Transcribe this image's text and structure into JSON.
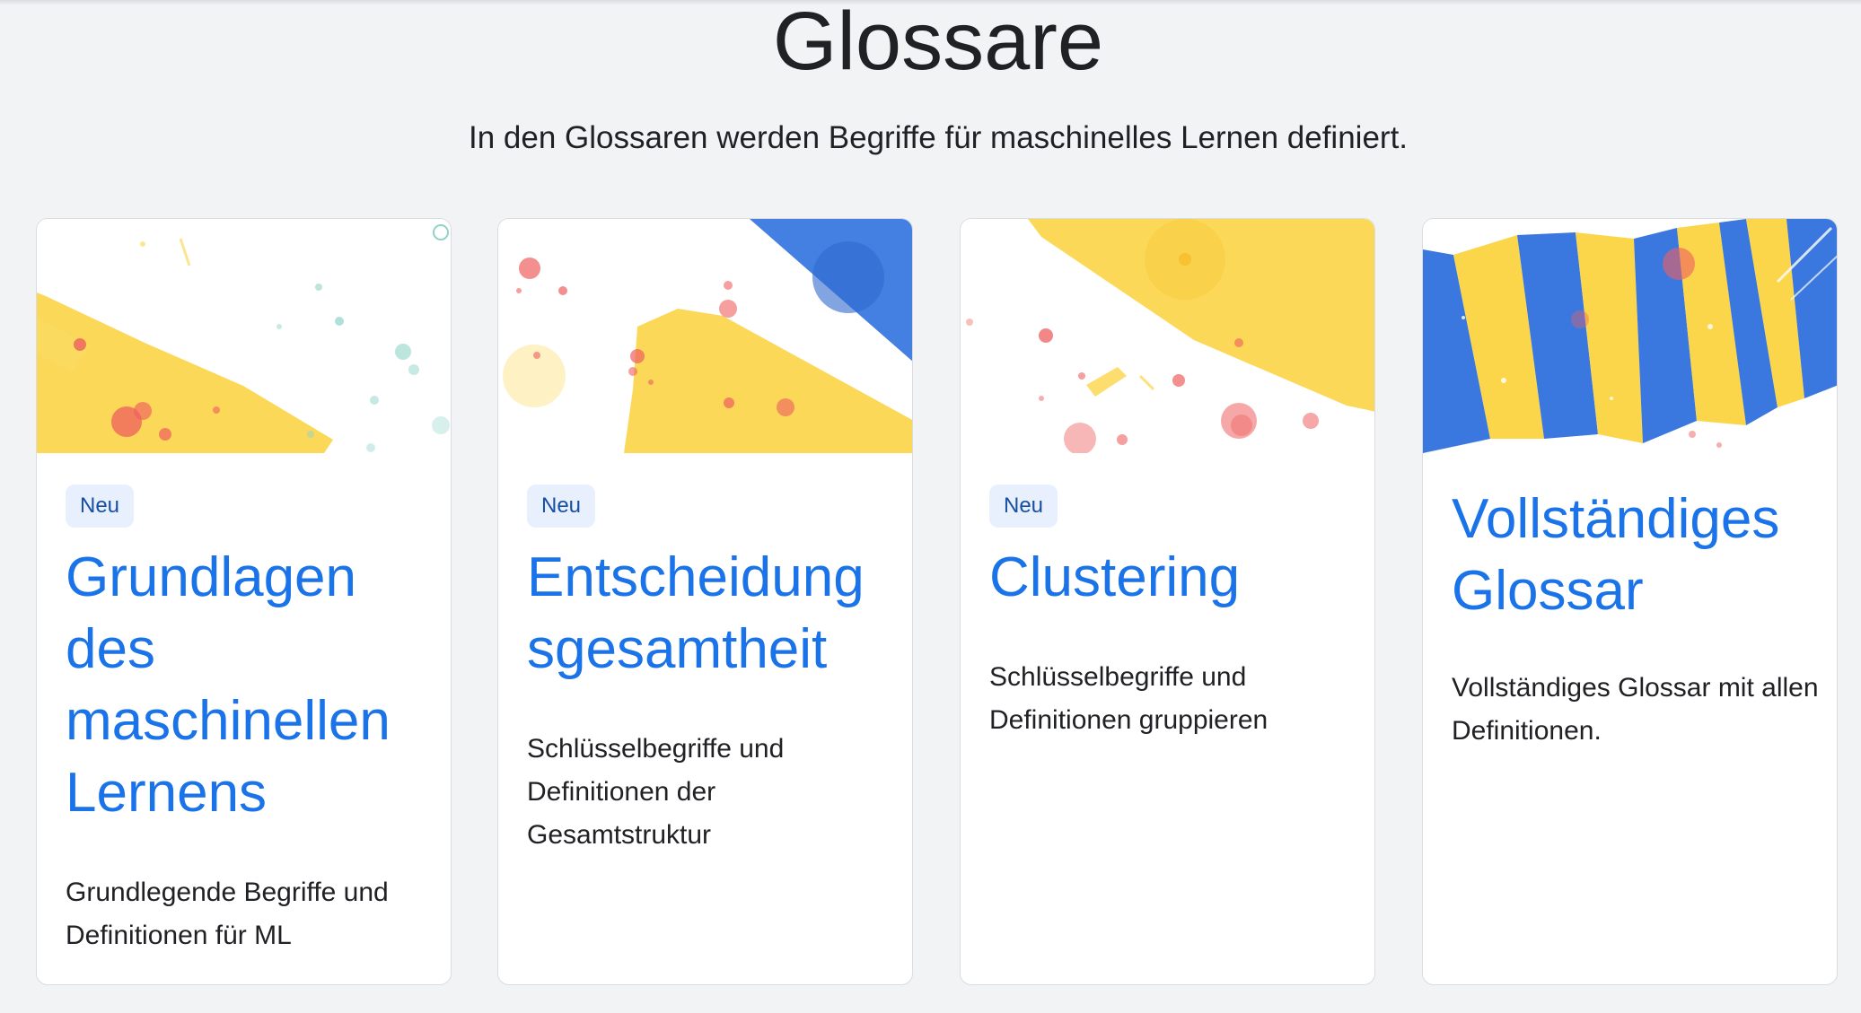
{
  "header": {
    "title": "Glossare",
    "subtitle": "In den Glossaren werden Begriffe für maschinelles Lernen definiert."
  },
  "cards": [
    {
      "badge": "Neu",
      "title": "Grundlagen des maschinellen Lernens",
      "description": "Grundlegende Begriffe und Definitionen für ML"
    },
    {
      "badge": "Neu",
      "title": "Entscheidung sgesamtheit",
      "description": "Schlüsselbegriffe und Definitionen der Gesamtstruktur"
    },
    {
      "badge": "Neu",
      "title": "Clustering",
      "description": "Schlüsselbegriffe und Definitionen gruppieren"
    },
    {
      "title": "Vollständiges Glossar",
      "description": "Vollständiges Glossar mit allen Definitionen."
    }
  ],
  "colors": {
    "link_blue": "#1a73e8",
    "badge_bg": "#e8f0fe",
    "badge_text": "#174ea6",
    "art_yellow": "#fbd54a",
    "art_blue": "#3a78e0",
    "art_red": "#ee5f5f",
    "art_teal": "#8fd3c8",
    "page_bg": "#f1f3f4"
  }
}
